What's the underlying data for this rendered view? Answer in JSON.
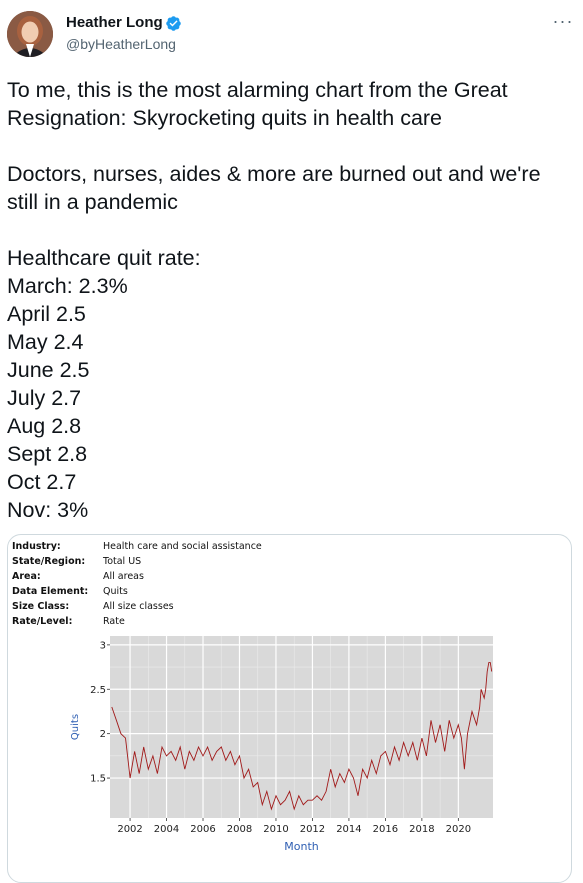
{
  "author": {
    "name": "Heather Long",
    "handle": "@byHeatherLong",
    "verified_icon": "verified-badge-icon",
    "avatar_icon": "profile-avatar",
    "more_icon": "more-options-icon"
  },
  "tweet": {
    "text": "To me, this is the most alarming chart from the Great Resignation: Skyrocketing quits in health care\n\nDoctors, nurses, aides & more are burned out and we're still in a pandemic\n\nHealthcare quit rate:\nMarch: 2.3%\nApril 2.5\nMay 2.4\nJune 2.5\nJuly 2.7\nAug 2.8\nSept 2.8\nOct 2.7\nNov: 3%"
  },
  "media": {
    "meta": [
      {
        "label": "Industry:",
        "value": "Health care and social assistance"
      },
      {
        "label": "State/Region:",
        "value": "Total US"
      },
      {
        "label": "Area:",
        "value": "All areas"
      },
      {
        "label": "Data Element:",
        "value": "Quits"
      },
      {
        "label": "Size Class:",
        "value": "All size classes"
      },
      {
        "label": "Rate/Level:",
        "value": "Rate"
      }
    ]
  },
  "colors": {
    "line": "#a11a1a",
    "panel": "#d9d9d9",
    "axis_title": "#2f5fb3",
    "verified": "#1d9bf0"
  },
  "chart_data": {
    "type": "line",
    "xlabel": "Month",
    "ylabel": "Quits",
    "xlim": [
      2000.9,
      2021.9
    ],
    "ylim": [
      1.05,
      3.1
    ],
    "x_ticks": [
      2002,
      2004,
      2006,
      2008,
      2010,
      2012,
      2014,
      2016,
      2018,
      2020
    ],
    "y_ticks": [
      1.5,
      2,
      2.5,
      3
    ],
    "y_tick_labels": [
      "1.5",
      "2",
      "2.5",
      "3"
    ],
    "grid": true,
    "series": [
      {
        "x": [
          2001.0,
          2001.25,
          2001.5,
          2001.75,
          2002.0,
          2002.25,
          2002.5,
          2002.75,
          2003.0,
          2003.25,
          2003.5,
          2003.75,
          2004.0,
          2004.25,
          2004.5,
          2004.75,
          2005.0,
          2005.25,
          2005.5,
          2005.75,
          2006.0,
          2006.25,
          2006.5,
          2006.75,
          2007.0,
          2007.25,
          2007.5,
          2007.75,
          2008.0,
          2008.25,
          2008.5,
          2008.75,
          2009.0,
          2009.25,
          2009.5,
          2009.75,
          2010.0,
          2010.25,
          2010.5,
          2010.75,
          2011.0,
          2011.25,
          2011.5,
          2011.75,
          2012.0,
          2012.25,
          2012.5,
          2012.75,
          2013.0,
          2013.25,
          2013.5,
          2013.75,
          2014.0,
          2014.25,
          2014.5,
          2014.75,
          2015.0,
          2015.25,
          2015.5,
          2015.75,
          2016.0,
          2016.25,
          2016.5,
          2016.75,
          2017.0,
          2017.25,
          2017.5,
          2017.75,
          2018.0,
          2018.25,
          2018.5,
          2018.75,
          2019.0,
          2019.25,
          2019.5,
          2019.75,
          2020.0,
          2020.17,
          2020.33,
          2020.5,
          2020.75,
          2021.0,
          2021.17,
          2021.25,
          2021.42,
          2021.5,
          2021.58,
          2021.67,
          2021.75,
          2021.83
        ],
        "values": [
          2.3,
          2.15,
          2.0,
          1.95,
          1.5,
          1.8,
          1.55,
          1.85,
          1.6,
          1.75,
          1.55,
          1.85,
          1.75,
          1.8,
          1.7,
          1.85,
          1.6,
          1.8,
          1.7,
          1.85,
          1.75,
          1.85,
          1.7,
          1.8,
          1.85,
          1.7,
          1.8,
          1.65,
          1.75,
          1.5,
          1.6,
          1.4,
          1.45,
          1.2,
          1.35,
          1.15,
          1.3,
          1.2,
          1.25,
          1.35,
          1.15,
          1.3,
          1.2,
          1.25,
          1.25,
          1.3,
          1.25,
          1.35,
          1.6,
          1.4,
          1.55,
          1.45,
          1.6,
          1.5,
          1.3,
          1.6,
          1.5,
          1.7,
          1.55,
          1.75,
          1.8,
          1.65,
          1.85,
          1.7,
          1.9,
          1.75,
          1.9,
          1.7,
          1.95,
          1.75,
          2.15,
          1.9,
          2.1,
          1.8,
          2.15,
          1.95,
          2.1,
          1.95,
          1.6,
          2.0,
          2.25,
          2.1,
          2.3,
          2.5,
          2.4,
          2.5,
          2.7,
          2.8,
          2.8,
          2.7
        ]
      }
    ]
  }
}
